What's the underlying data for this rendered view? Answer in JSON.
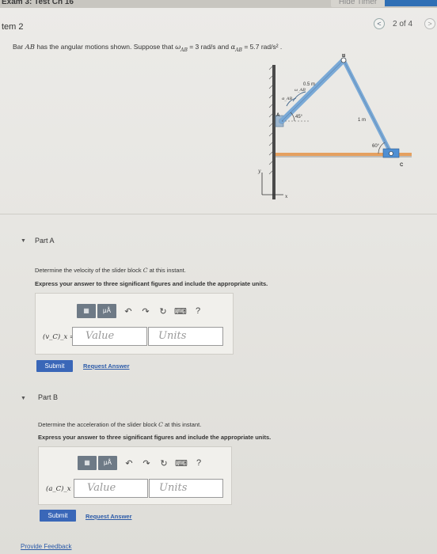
{
  "header": {
    "exam_title": "Exam 3: Test Ch 16",
    "hide_timer": "Hide Timer",
    "item_title": "tem 2",
    "page_count": "2 of 4",
    "prev_icon": "chevron-left-icon",
    "next_icon": "chevron-right-icon"
  },
  "problem": {
    "prefix": "Bar ",
    "bar": "AB",
    "middle1": " has the angular motions shown. Suppose that ",
    "omega": "ω",
    "omega_sub": "AB",
    "omega_val": " = 3  rad/s",
    "and": " and ",
    "alpha": "α",
    "alpha_sub": "AB",
    "alpha_val": " = 5.7  rad/s²",
    "end": " ."
  },
  "figure": {
    "label_B": "B",
    "label_A": "A",
    "label_C": "C",
    "label_len_ab": "0.5 m",
    "label_len_bc": "1 m",
    "label_angle_a": "45°",
    "label_angle_c": "60°",
    "label_omega": "ω_AB",
    "label_alpha": "α_AB",
    "axis_y": "y",
    "axis_x": "x"
  },
  "partA": {
    "title": "Part A",
    "instr1_prefix": "Determine the velocity of the slider block ",
    "instr1_var": "C",
    "instr1_suffix": " at this instant.",
    "instr2": "Express your answer to three significant figures and include the appropriate units.",
    "var_label": "(v_C)_x =",
    "value_placeholder": "Value",
    "units_placeholder": "Units",
    "submit": "Submit",
    "request": "Request Answer",
    "tb_mu": "μÅ",
    "tb_help": "?"
  },
  "partB": {
    "title": "Part B",
    "instr1_prefix": "Determine the acceleration of the slider block ",
    "instr1_var": "C",
    "instr1_suffix": " at this instant.",
    "instr2": "Express your answer to three significant figures and include the appropriate units.",
    "var_label": "(a_C)_x =",
    "value_placeholder": "Value",
    "units_placeholder": "Units",
    "submit": "Submit",
    "request": "Request Answer",
    "tb_mu": "μÅ",
    "tb_help": "?"
  },
  "footer": {
    "provide_feedback": "Provide Feedback"
  },
  "colors": {
    "accent": "#2f6fb5",
    "submit": "#3a67b8",
    "bar": "#7aa9d6",
    "slider": "#4f8fd3",
    "floor": "#e5a060"
  }
}
